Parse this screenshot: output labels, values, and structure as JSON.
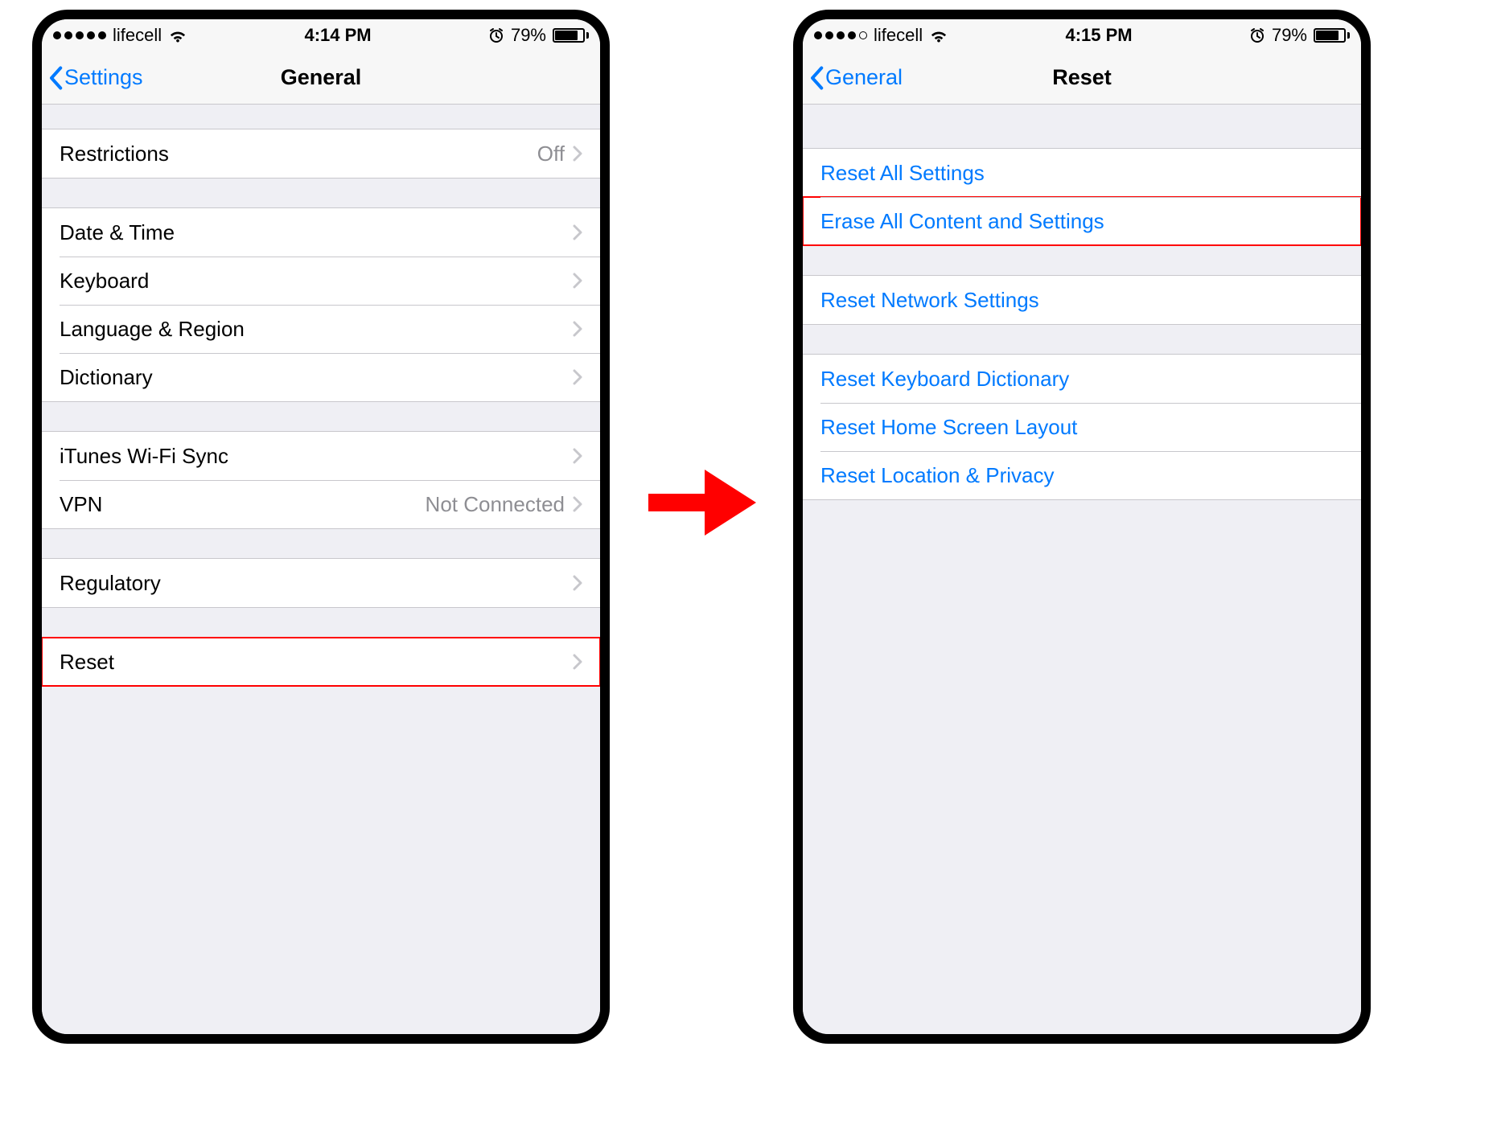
{
  "left": {
    "status": {
      "signal_filled": 5,
      "signal_total": 5,
      "carrier": "lifecell",
      "time": "4:14 PM",
      "battery_pct": "79%",
      "battery_fill_pct": 79
    },
    "nav": {
      "back": "Settings",
      "title": "General"
    },
    "groups": [
      [
        {
          "label": "Restrictions",
          "value": "Off",
          "chevron": true
        }
      ],
      [
        {
          "label": "Date & Time",
          "chevron": true
        },
        {
          "label": "Keyboard",
          "chevron": true
        },
        {
          "label": "Language & Region",
          "chevron": true
        },
        {
          "label": "Dictionary",
          "chevron": true
        }
      ],
      [
        {
          "label": "iTunes Wi-Fi Sync",
          "chevron": true
        },
        {
          "label": "VPN",
          "value": "Not Connected",
          "chevron": true
        }
      ],
      [
        {
          "label": "Regulatory",
          "chevron": true
        }
      ],
      [
        {
          "label": "Reset",
          "chevron": true,
          "highlight": true
        }
      ]
    ]
  },
  "right": {
    "status": {
      "signal_filled": 4,
      "signal_total": 5,
      "carrier": "lifecell",
      "time": "4:15 PM",
      "battery_pct": "79%",
      "battery_fill_pct": 79
    },
    "nav": {
      "back": "General",
      "title": "Reset"
    },
    "groups": [
      [
        {
          "label": "Reset All Settings",
          "blue": true
        },
        {
          "label": "Erase All Content and Settings",
          "blue": true,
          "highlight": true
        }
      ],
      [
        {
          "label": "Reset Network Settings",
          "blue": true
        }
      ],
      [
        {
          "label": "Reset Keyboard Dictionary",
          "blue": true
        },
        {
          "label": "Reset Home Screen Layout",
          "blue": true
        },
        {
          "label": "Reset Location & Privacy",
          "blue": true
        }
      ]
    ]
  }
}
